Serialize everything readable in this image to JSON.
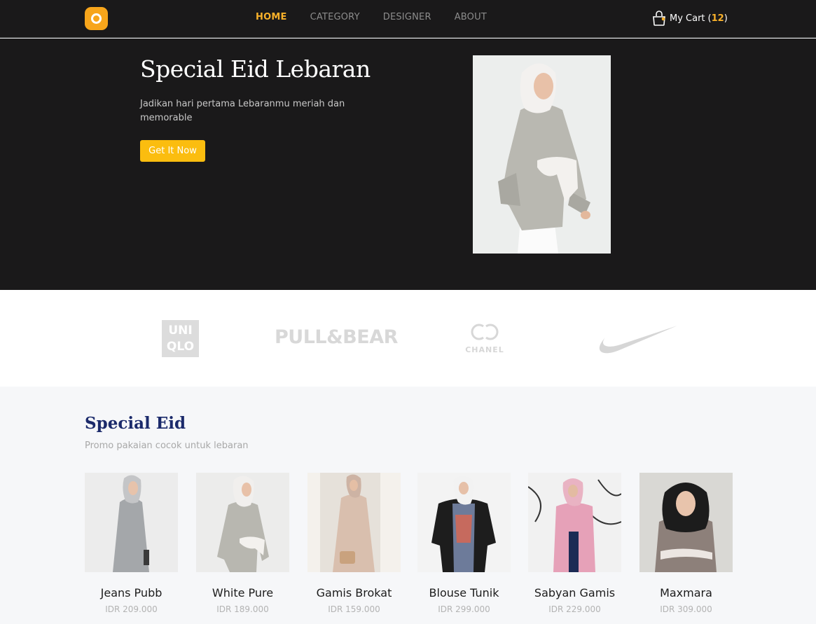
{
  "nav": {
    "logo": "logo-icon",
    "menu": [
      {
        "label": "HOME",
        "active": true
      },
      {
        "label": "CATEGORY",
        "active": false
      },
      {
        "label": "DESIGNER",
        "active": false
      },
      {
        "label": "ABOUT",
        "active": false
      }
    ],
    "cart_label": "My Cart",
    "cart_count_open": "(",
    "cart_count": "12",
    "cart_count_close": ")",
    "cart_icon": "shopping-bag-icon"
  },
  "hero": {
    "title": "Special Eid Lebaran",
    "subtitle": "Jadikan hari pertama Lebaranmu meriah dan memorable",
    "button_label": "Get It Now",
    "image": "model-photo"
  },
  "brands": {
    "uniqlo": [
      "UNI",
      "QLO"
    ],
    "pullbear": "PULL&BEAR",
    "chanel": "CHANEL",
    "nike": "nike-swoosh-logo"
  },
  "special": {
    "title": "Special Eid",
    "subtitle": "Promo pakaian cocok untuk lebaran",
    "products": [
      {
        "name": "Jeans Pubb",
        "price": "IDR 209.000"
      },
      {
        "name": "White Pure",
        "price": "IDR 189.000"
      },
      {
        "name": "Gamis Brokat",
        "price": "IDR 159.000"
      },
      {
        "name": "Blouse Tunik",
        "price": "IDR 299.000"
      },
      {
        "name": "Sabyan Gamis",
        "price": "IDR 229.000"
      },
      {
        "name": "Maxmara",
        "price": "IDR 309.000"
      }
    ]
  },
  "colors": {
    "accent": "#f9b12a",
    "button": "#fbbd0f",
    "dark": "#1a191a",
    "heading": "#1b2a6b"
  }
}
